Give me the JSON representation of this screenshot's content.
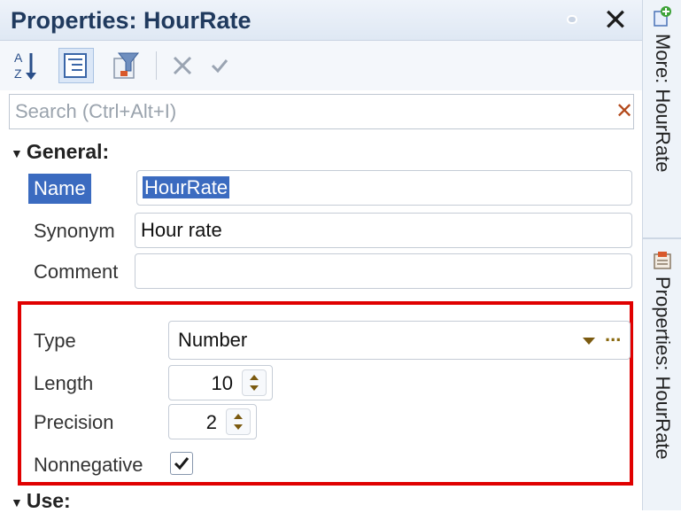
{
  "panel": {
    "title": "Properties: HourRate"
  },
  "toolbar": {
    "buttons": [
      "sort-az",
      "categorized",
      "filter",
      "cancel",
      "apply"
    ]
  },
  "search": {
    "placeholder": "Search (Ctrl+Alt+I)",
    "value": ""
  },
  "general": {
    "header": "General:",
    "name_label": "Name",
    "name_value": "HourRate",
    "synonym_label": "Synonym",
    "synonym_value": "Hour rate",
    "comment_label": "Comment",
    "comment_value": ""
  },
  "type_group": {
    "type_label": "Type",
    "type_value": "Number",
    "dots": "...",
    "length_label": "Length",
    "length_value": "10",
    "precision_label": "Precision",
    "precision_value": "2",
    "nonnegative_label": "Nonnegative",
    "nonnegative_checked": true
  },
  "use": {
    "header": "Use:"
  },
  "sidebar": {
    "tab1": "More: HourRate",
    "tab2": "Properties: HourRate"
  },
  "colors": {
    "highlight": "#e00000",
    "selection": "#3b6bc0"
  }
}
